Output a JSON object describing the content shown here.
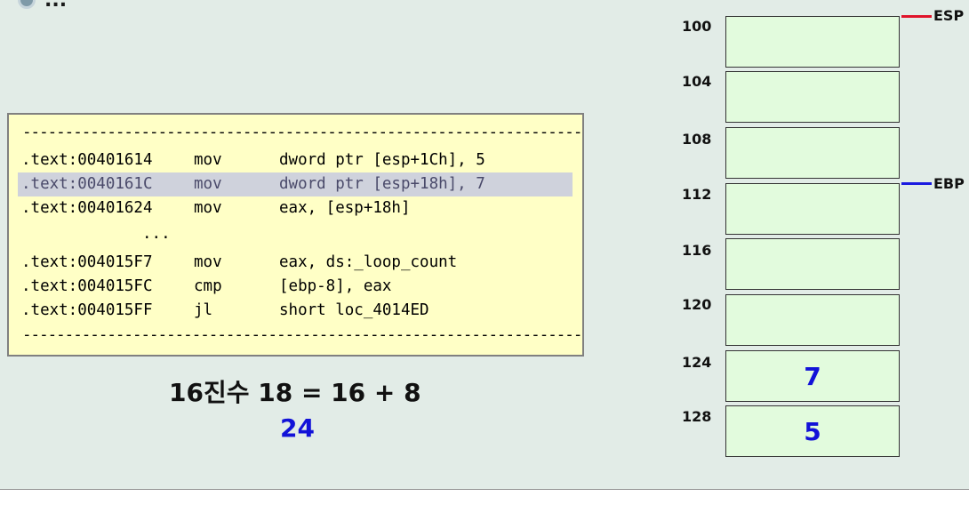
{
  "header": {
    "title": "..."
  },
  "code": {
    "dashes": "------------------------------------------------------------------------",
    "lines": [
      {
        "addr": ".text:00401614",
        "op": "mov",
        "args": "dword ptr [esp+1Ch], 5"
      },
      {
        "addr": ".text:0040161C",
        "op": "mov",
        "args": "dword ptr [esp+18h], 7"
      },
      {
        "addr": ".text:00401624",
        "op": "mov",
        "args": "eax, [esp+18h]"
      },
      {
        "addr": ".text:004015F7",
        "op": "mov",
        "args": "eax, ds:_loop_count"
      },
      {
        "addr": ".text:004015FC",
        "op": "cmp",
        "args": "[ebp-8], eax"
      },
      {
        "addr": ".text:004015FF",
        "op": "jl",
        "args": "short loc_4014ED"
      }
    ],
    "ellipsis": "..."
  },
  "calc": {
    "expr": "16진수 18 = 16 + 8",
    "result": "24"
  },
  "stack": {
    "cells": [
      {
        "addr": "100",
        "value": ""
      },
      {
        "addr": "104",
        "value": ""
      },
      {
        "addr": "108",
        "value": ""
      },
      {
        "addr": "112",
        "value": ""
      },
      {
        "addr": "116",
        "value": ""
      },
      {
        "addr": "120",
        "value": ""
      },
      {
        "addr": "124",
        "value": "7"
      },
      {
        "addr": "128",
        "value": "5"
      }
    ],
    "esp_label": "ESP",
    "ebp_label": "EBP",
    "esp_color": "#e0142a",
    "ebp_color": "#1a1ae0"
  },
  "colors": {
    "code_bg": "#ffffc6",
    "cell_bg": "#e2fbdd",
    "accent_blue": "#1212d8"
  }
}
